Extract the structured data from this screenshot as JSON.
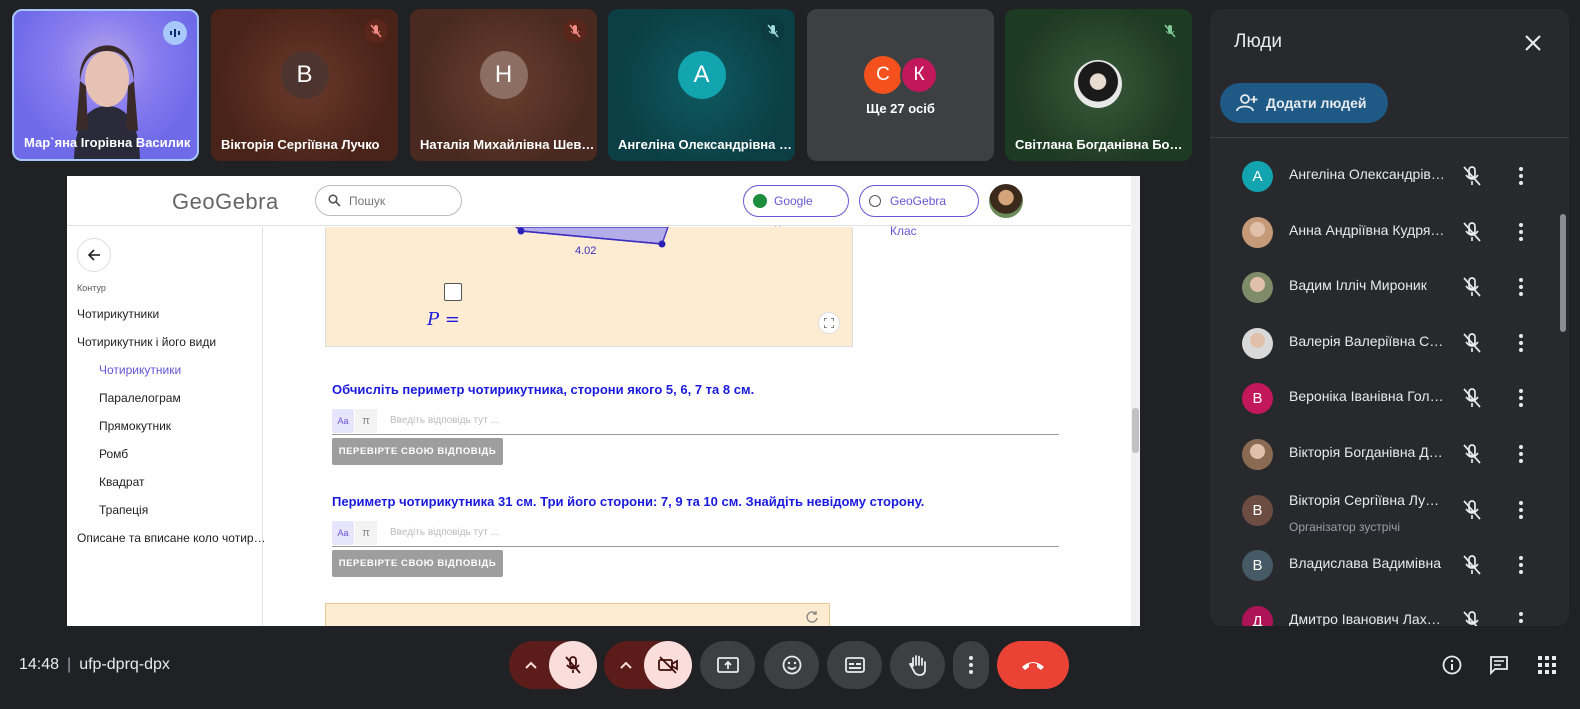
{
  "tiles": [
    {
      "name": "Мар`яна Ігорівна Василик",
      "speaking": true
    },
    {
      "name": "Вікторія Сергіївна Лучко",
      "initial": "В"
    },
    {
      "name": "Наталія Михайлівна Шев…",
      "initial": "Н"
    },
    {
      "name": "Ангеліна Олександрівна …",
      "initial": "А"
    },
    {
      "more_label": "Ще 27 осіб",
      "initials": [
        "С",
        "К"
      ]
    },
    {
      "name": "Світлана Богданівна Бо…"
    }
  ],
  "geogebra": {
    "logo": "GeoGebra",
    "search_placeholder": "Пошук",
    "google_class": "Google Клас",
    "geogebra_class": "GeoGebra Клас",
    "side_caption": "Контур",
    "nav": [
      "Чотирикутники",
      "Чотирикутник і його види",
      "Чотирикутники",
      "Паралелограм",
      "Прямокутник",
      "Ромб",
      "Квадрат",
      "Трапеція",
      "Описане та вписане коло чотир…"
    ],
    "applet": {
      "side_value": "4.02",
      "formula": "P ="
    },
    "questions": [
      {
        "text": "Обчисліть периметр чотирикутника, сторони якого 5, 6, 7 та 8 см.",
        "kb_text": "Aa",
        "kb_math": "π",
        "placeholder": "Введіть відповідь тут ...",
        "button": "ПЕРЕВІРТЕ СВОЮ ВІДПОВІДЬ"
      },
      {
        "text": "Периметр чотирикутника 31 см. Три його сторони: 7, 9 та 10 см. Знайдіть невідому сторону.",
        "kb_text": "Aa",
        "kb_math": "π",
        "placeholder": "Введіть відповідь тут ...",
        "button": "ПЕРЕВІРТЕ СВОЮ ВІДПОВІДЬ"
      }
    ]
  },
  "panel": {
    "title": "Люди",
    "add_button": "Додати людей",
    "people": [
      {
        "name": "Ангеліна Олександрівна",
        "initial": "А",
        "color": "#12a4af"
      },
      {
        "name": "Анна Андріївна Кудрявцева",
        "initial": "",
        "color": "#c49a78"
      },
      {
        "name": "Вадим Ілліч Мироник",
        "initial": "",
        "color": "#7f8c6a"
      },
      {
        "name": "Валерія Валеріївна Сімко",
        "initial": "",
        "color": "#d9d9d9"
      },
      {
        "name": "Вероніка Іванівна Голей",
        "initial": "В",
        "color": "#c2185b"
      },
      {
        "name": "Вікторія Богданівна Дронь",
        "initial": "",
        "color": "#8a6b52"
      },
      {
        "name": "Вікторія Сергіївна Лучко",
        "initial": "В",
        "color": "#6d4c41",
        "role": "Організатор зустрічі"
      },
      {
        "name": "Владислава Вадимівна",
        "initial": "В",
        "color": "#455a64"
      },
      {
        "name": "Дмитро Іванович Лахман",
        "initial": "Д",
        "color": "#ad1457"
      }
    ]
  },
  "bottom": {
    "time": "14:48",
    "meeting_code": "ufp-dprq-dpx"
  },
  "colors": {
    "accent": "#6557d2",
    "question": "#1a1adf",
    "end_call": "#ea4335",
    "muted_bg": "#f9dedc"
  }
}
